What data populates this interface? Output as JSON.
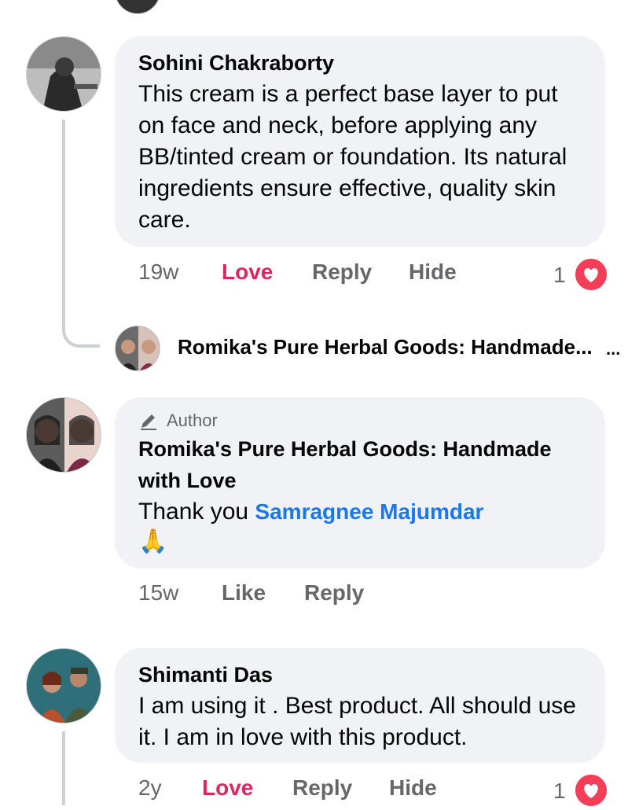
{
  "comments": [
    {
      "name": "Sohini Chakraborty",
      "text": "This cream is a perfect base layer to put on face and neck, before applying any BB/tinted cream or foundation. Its natural ingredients ensure effective, quality skin care.",
      "time": "19w",
      "actions": [
        "Love",
        "Reply",
        "Hide"
      ],
      "reaction_count": "1",
      "reaction_icon": "heart-icon"
    },
    {
      "reply_preview_name": "Romika's Pure Herbal Goods: Handmade...",
      "reply_preview_more": "..."
    },
    {
      "badge": "Author",
      "name": "Romika's Pure Herbal Goods: Handmade with Love",
      "text_prefix": "Thank you ",
      "mention": "Samragnee Majumdar",
      "emoji": "🙏",
      "time": "15w",
      "actions": [
        "Like",
        "Reply"
      ]
    },
    {
      "name": "Shimanti Das",
      "text": "I am using it . Best product. All should use it. I am in love with this product.",
      "time": "2y",
      "actions": [
        "Love",
        "Reply",
        "Hide"
      ],
      "reaction_count": "1",
      "reaction_icon": "heart-icon"
    }
  ],
  "colors": {
    "love": "#e0245e",
    "link": "#1877f2",
    "bubble": "#f0f2f5",
    "heart": "#f33e58"
  }
}
